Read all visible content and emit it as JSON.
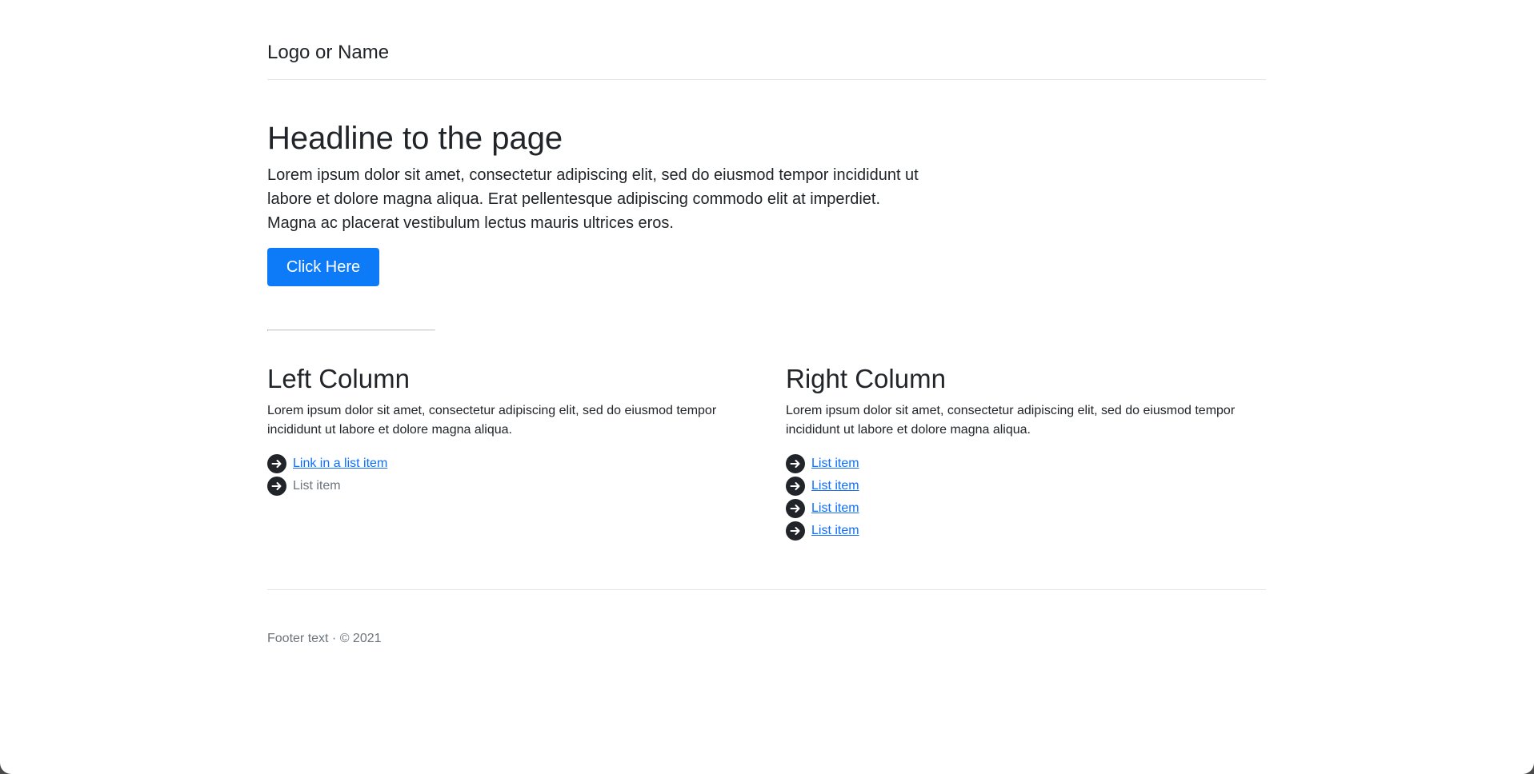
{
  "header": {
    "brand": "Logo or Name"
  },
  "hero": {
    "title": "Headline to the page",
    "lead": "Lorem ipsum dolor sit amet, consectetur adipiscing elit, sed do eiusmod tempor incididunt ut labore et dolore magna aliqua. Erat pellentesque adipiscing commodo elit at imperdiet. Magna ac placerat vestibulum lectus mauris ultrices eros.",
    "button_label": "Click Here"
  },
  "left_column": {
    "title": "Left Column",
    "text": "Lorem ipsum dolor sit amet, consectetur adipiscing elit, sed do eiusmod tempor incididunt ut labore et dolore magna aliqua.",
    "items": [
      {
        "label": "Link in a list item",
        "is_link": true
      },
      {
        "label": "List item",
        "is_link": false
      }
    ]
  },
  "right_column": {
    "title": "Right Column",
    "text": "Lorem ipsum dolor sit amet, consectetur adipiscing elit, sed do eiusmod tempor incididunt ut labore et dolore magna aliqua.",
    "items": [
      {
        "label": "List item",
        "is_link": true
      },
      {
        "label": "List item",
        "is_link": true
      },
      {
        "label": "List item",
        "is_link": true
      },
      {
        "label": "List item",
        "is_link": true
      }
    ]
  },
  "footer": {
    "text": "Footer text · © 2021"
  },
  "icons": {
    "list_bullet": "arrow-right-circle-icon"
  },
  "colors": {
    "primary": "#0d7bf7",
    "link": "#0d6efd",
    "text": "#212529",
    "muted": "#6c757d",
    "icon": "#212529"
  }
}
